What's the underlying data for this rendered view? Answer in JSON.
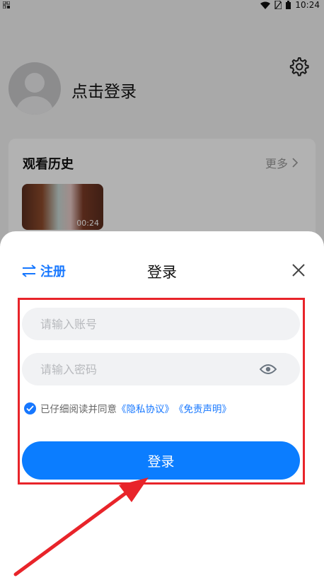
{
  "statusbar": {
    "time": "10:24",
    "icons": [
      "notification-icon",
      "wifi-icon",
      "sim-icon",
      "battery-icon"
    ]
  },
  "profile": {
    "login_prompt": "点击登录",
    "icons": [
      "settings-gear-icon",
      "avatar-placeholder-icon"
    ]
  },
  "history": {
    "title": "观看历史",
    "more_label": "更多",
    "items": [
      {
        "duration": "00:24"
      }
    ]
  },
  "login_sheet": {
    "register_label": "注册",
    "title": "登录",
    "account_placeholder": "请输入账号",
    "password_placeholder": "请输入密码",
    "agreement": {
      "prefix": "已仔细阅读并同意",
      "privacy_link": "《隐私协议》",
      "disclaimer_link": "《免责声明》",
      "checked": true
    },
    "login_button": "登录"
  },
  "colors": {
    "accent": "#1677ff",
    "button": "#0b7dff",
    "annotation": "#e8242a",
    "input_bg": "#f1f2f4"
  }
}
